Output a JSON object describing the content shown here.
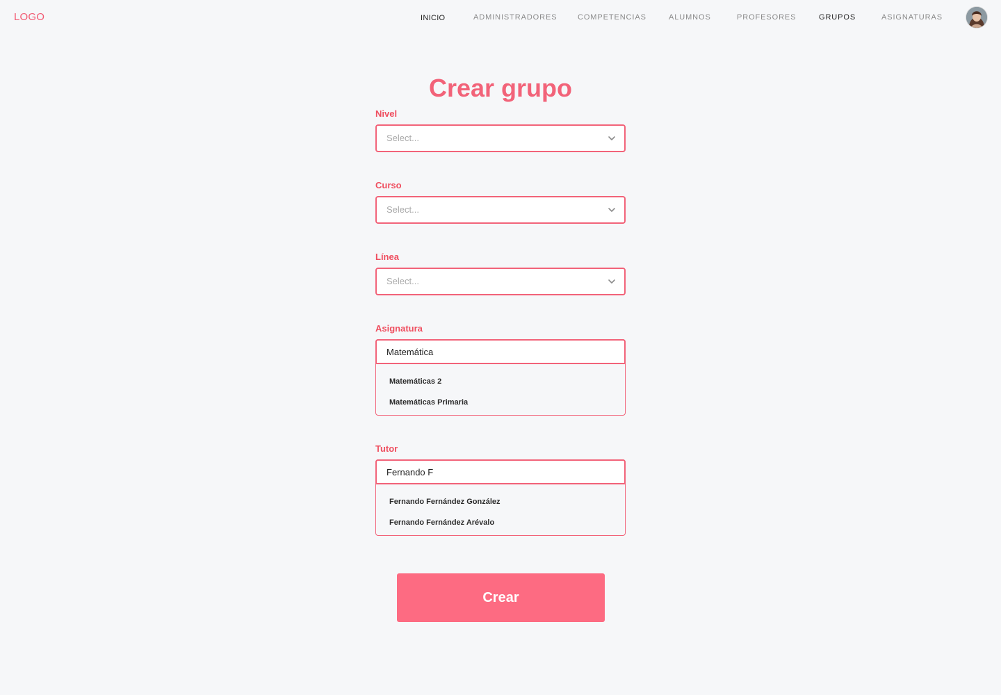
{
  "header": {
    "logo": "LOGO",
    "nav": [
      {
        "label": "INICIO",
        "active": true
      },
      {
        "label": "ADMINISTRADORES",
        "active": false
      },
      {
        "label": "COMPETENCIAS",
        "active": false
      },
      {
        "label": "ALUMNOS",
        "active": false
      },
      {
        "label": "PROFESORES",
        "active": false
      },
      {
        "label": "GRUPOS",
        "active": true
      },
      {
        "label": "ASIGNATURAS",
        "active": false
      }
    ],
    "avatar_icon": "user-avatar"
  },
  "form": {
    "title": "Crear grupo",
    "nivel": {
      "label": "Nivel",
      "placeholder": "Select..."
    },
    "curso": {
      "label": "Curso",
      "placeholder": "Select..."
    },
    "linea": {
      "label": "Línea",
      "placeholder": "Select..."
    },
    "asignatura": {
      "label": "Asignatura",
      "value": "Matemática",
      "options": [
        "Matemáticas 2",
        "Matemáticas Primaria"
      ]
    },
    "tutor": {
      "label": "Tutor",
      "value": "Fernando F",
      "options": [
        "Fernando Fernández González",
        "Fernando Fernández Arévalo"
      ]
    },
    "submit_label": "Crear"
  },
  "colors": {
    "accent": "#f26379",
    "label": "#ef4f60",
    "button": "#fd6b82",
    "background": "#f6f7f9"
  }
}
